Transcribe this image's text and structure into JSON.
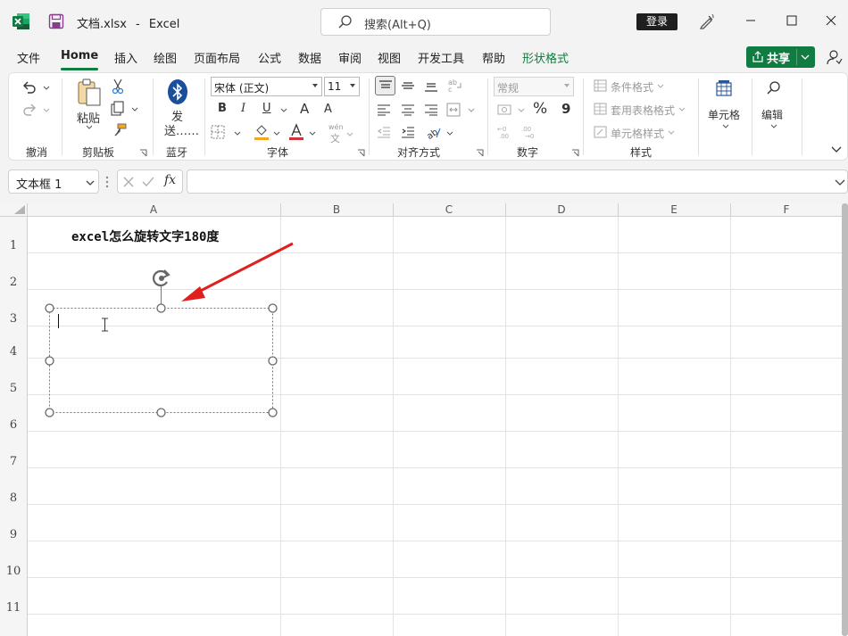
{
  "titlebar": {
    "file_name": "文档.xlsx",
    "separator": "-",
    "app_name": "Excel",
    "search_placeholder": "搜索(Alt+Q)",
    "login_label": "登录"
  },
  "tabs": [
    "文件",
    "Home",
    "插入",
    "绘图",
    "页面布局",
    "公式",
    "数据",
    "审阅",
    "视图",
    "开发工具",
    "帮助",
    "形状格式"
  ],
  "active_tab": "Home",
  "share_label": "共享",
  "ribbon": {
    "groups": [
      "撤消",
      "剪贴板",
      "蓝牙",
      "字体",
      "对齐方式",
      "数字",
      "样式"
    ],
    "paste_label": "粘贴",
    "send_label_1": "发",
    "send_label_2": "送……",
    "font_name": "宋体 (正文)",
    "font_size": "11",
    "bold": "B",
    "italic": "I",
    "underline": "U",
    "grow_font": "A",
    "shrink_font": "A",
    "phonetic": "wén",
    "phonetic_char": "文",
    "number_format": "常规",
    "percent": "%",
    "comma": "9",
    "cond_format": "条件格式",
    "table_format": "套用表格格式",
    "cell_style": "单元格样式",
    "cells_label": "单元格",
    "edit_label": "编辑"
  },
  "formula_bar": {
    "name_box": "文本框 1",
    "fx": "fx",
    "formula": ""
  },
  "grid": {
    "columns": [
      "A",
      "B",
      "C",
      "D",
      "E",
      "F"
    ],
    "rows": [
      "1",
      "2",
      "3",
      "4",
      "5",
      "6",
      "7",
      "8",
      "9",
      "10",
      "11"
    ],
    "cell_a1": "excel怎么旋转文字180度"
  },
  "colors": {
    "accent_green": "#107c41",
    "arrow_red": "#e02020",
    "font_color_red": "#d13438",
    "highlight_orange": "#f5a623"
  }
}
